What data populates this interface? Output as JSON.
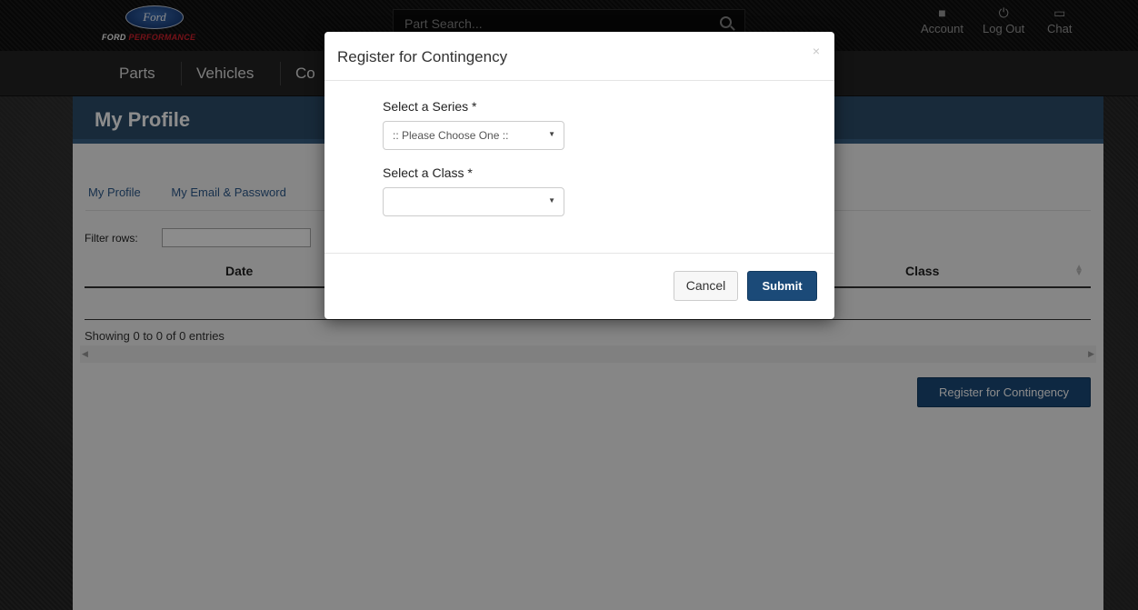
{
  "header": {
    "logo_oval_text": "Ford",
    "logo_word_1": "FORD",
    "logo_word_2": "PERFORMANCE",
    "search": {
      "placeholder": "Part Search..."
    },
    "actions": [
      {
        "label": "Account",
        "icon": "account-icon"
      },
      {
        "label": "Log Out",
        "icon": "power-icon"
      },
      {
        "label": "Chat",
        "icon": "chat-icon"
      }
    ]
  },
  "nav": {
    "items": [
      "Parts",
      "Vehicles",
      "Co"
    ]
  },
  "page": {
    "title": "My Profile",
    "tabs": [
      "My Profile",
      "My Email & Password"
    ],
    "filter_label": "Filter rows:",
    "table": {
      "columns": [
        "Date",
        "Class"
      ],
      "rows": []
    },
    "info": "Showing 0 to 0 of 0 entries",
    "register_button": "Register for Contingency"
  },
  "modal": {
    "title": "Register for Contingency",
    "close_symbol": "×",
    "series_label": "Select a Series *",
    "series_value": ":: Please Choose One ::",
    "class_label": "Select a Class *",
    "class_value": "",
    "cancel_label": "Cancel",
    "submit_label": "Submit"
  },
  "colors": {
    "header_blue": "#2d4e6b",
    "button_blue": "#1b4a78",
    "brand_red": "#d4202c"
  }
}
